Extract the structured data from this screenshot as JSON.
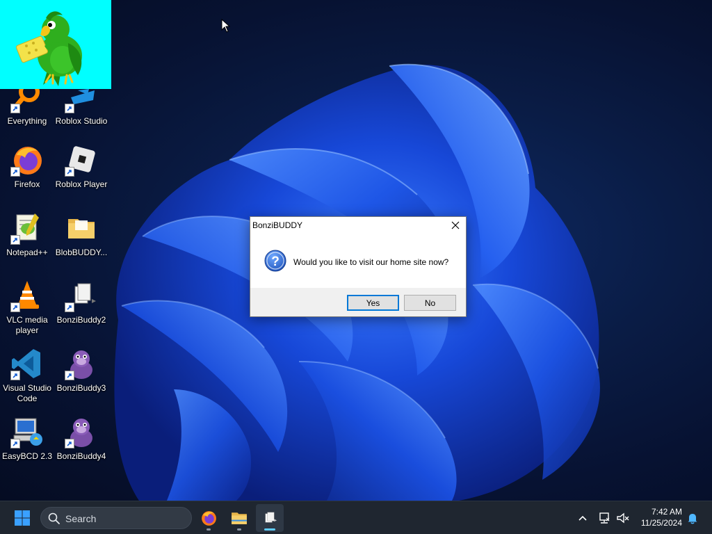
{
  "desktop": {
    "icons": [
      {
        "label": "Everything",
        "icon": "everything-search-icon",
        "shortcut": true
      },
      {
        "label": "Roblox Studio",
        "icon": "roblox-studio-icon",
        "shortcut": true
      },
      {
        "label": "Firefox",
        "icon": "firefox-icon",
        "shortcut": true
      },
      {
        "label": "Roblox Player",
        "icon": "roblox-player-icon",
        "shortcut": true
      },
      {
        "label": "Notepad++",
        "icon": "notepad-plus-plus-icon",
        "shortcut": true
      },
      {
        "label": "BlobBUDDY...",
        "icon": "folder-icon",
        "shortcut": false
      },
      {
        "label": "VLC media player",
        "icon": "vlc-icon",
        "shortcut": true
      },
      {
        "label": "BonziBuddy2",
        "icon": "bonzibuddy-file-icon",
        "shortcut": true
      },
      {
        "label": "Visual Studio Code",
        "icon": "vscode-icon",
        "shortcut": true
      },
      {
        "label": "BonziBuddy3",
        "icon": "bonzibuddy-gorilla-icon",
        "shortcut": true
      },
      {
        "label": "EasyBCD 2.3",
        "icon": "easybcd-icon",
        "shortcut": true
      },
      {
        "label": "BonziBuddy4",
        "icon": "bonzibuddy-gorilla-icon",
        "shortcut": true
      }
    ]
  },
  "bonzi_window": {
    "character": "parrot-character",
    "background": "#00ffff"
  },
  "dialog": {
    "title": "BonziBUDDY",
    "message": "Would you like to visit our home site now?",
    "icon": "question-icon",
    "buttons": {
      "yes": "Yes",
      "no": "No"
    }
  },
  "taskbar": {
    "start_icon": "windows-start-icon",
    "search_label": "Search",
    "pinned": [
      {
        "name": "firefox",
        "icon": "firefox-icon",
        "active": false
      },
      {
        "name": "file-explorer",
        "icon": "folder-icon",
        "active": false
      },
      {
        "name": "bonzibuddy",
        "icon": "bonzibuddy-file-icon",
        "active": true
      }
    ],
    "tray": {
      "overflow_icon": "chevron-up-icon",
      "network_icon": "network-icon",
      "volume_icon": "volume-muted-icon",
      "notification_icon": "bell-icon"
    },
    "clock": {
      "time": "7:42 AM",
      "date": "11/25/2024"
    }
  },
  "colors": {
    "accent": "#0078d7",
    "taskbar": "#1f2630",
    "wallpaper_dark": "#071232",
    "wallpaper_bloom": "#1a55e8"
  }
}
